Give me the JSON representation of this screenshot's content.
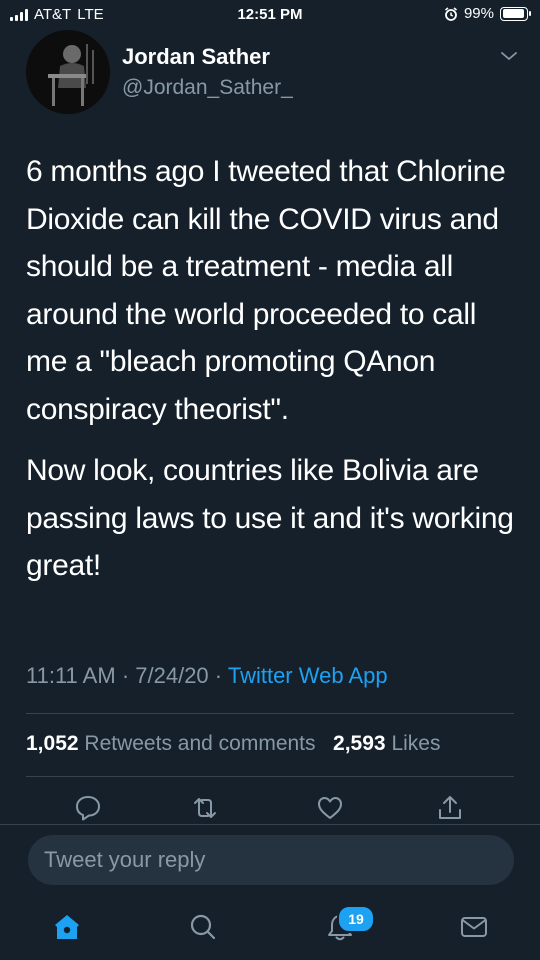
{
  "status_bar": {
    "carrier": "AT&T",
    "network": "LTE",
    "time": "12:51 PM",
    "battery": "99%",
    "battery_level": 0.99,
    "icons": [
      "signal-bars-icon",
      "alarm-icon",
      "battery-icon"
    ]
  },
  "tweet": {
    "author_name": "Jordan Sather",
    "author_handle": "@Jordan_Sather_",
    "paragraphs": [
      "6 months ago I tweeted that Chlorine Dioxide can kill the COVID virus and should be a treatment - media all around the world proceeded to call me a \"bleach promoting QAnon conspiracy theorist\".",
      "Now look, countries like Bolivia are passing laws to use it and it's working great!"
    ],
    "time": "11:11 AM",
    "separator": "·",
    "date": "7/24/20",
    "source": "Twitter Web App",
    "retweets_count": "1,052",
    "retweets_label": "Retweets and comments",
    "likes_count": "2,593",
    "likes_label": "Likes"
  },
  "actions": [
    "reply-icon",
    "retweet-icon",
    "like-icon",
    "share-icon"
  ],
  "reply": {
    "placeholder": "Tweet your reply"
  },
  "tab_bar": {
    "tabs": [
      "home-icon",
      "search-icon",
      "notifications-icon",
      "messages-icon"
    ],
    "notifications_badge": "19"
  },
  "colors": {
    "background": "#15202b",
    "accent": "#1da1f2",
    "secondary_text": "#8899a6",
    "divider": "#38444d"
  }
}
